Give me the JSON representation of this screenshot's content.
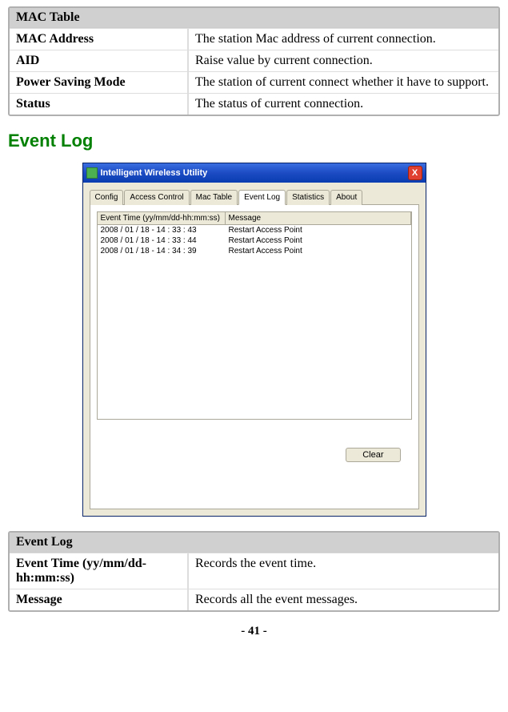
{
  "mac_table": {
    "title": "MAC Table",
    "rows": [
      {
        "label": "MAC Address",
        "desc": "The station Mac address of current connection."
      },
      {
        "label": "AID",
        "desc": "Raise value by current connection."
      },
      {
        "label": "Power Saving Mode",
        "desc": "The station of current connect whether it have to support."
      },
      {
        "label": "Status",
        "desc": "The status of current connection."
      }
    ]
  },
  "section_title": "Event Log",
  "app_window": {
    "title": "Intelligent Wireless Utility",
    "close": "X",
    "tabs": [
      "Config",
      "Access Control",
      "Mac Table",
      "Event Log",
      "Statistics",
      "About"
    ],
    "active_tab": "Event Log",
    "columns": {
      "time": "Event Time (yy/mm/dd-hh:mm:ss)",
      "msg": "Message"
    },
    "rows": [
      {
        "time": "2008 / 01 / 18 - 14 : 33 : 43",
        "msg": "Restart Access Point"
      },
      {
        "time": "2008 / 01 / 18 - 14 : 33 : 44",
        "msg": "Restart Access Point"
      },
      {
        "time": "2008 / 01 / 18 - 14 : 34 : 39",
        "msg": "Restart Access Point"
      }
    ],
    "clear_btn": "Clear"
  },
  "event_log_table": {
    "title": "Event Log",
    "rows": [
      {
        "label": "Event Time (yy/mm/dd-hh:mm:ss)",
        "desc": "Records the event time."
      },
      {
        "label": "Message",
        "desc": "Records all the event messages."
      }
    ]
  },
  "page_number": "- 41 -"
}
